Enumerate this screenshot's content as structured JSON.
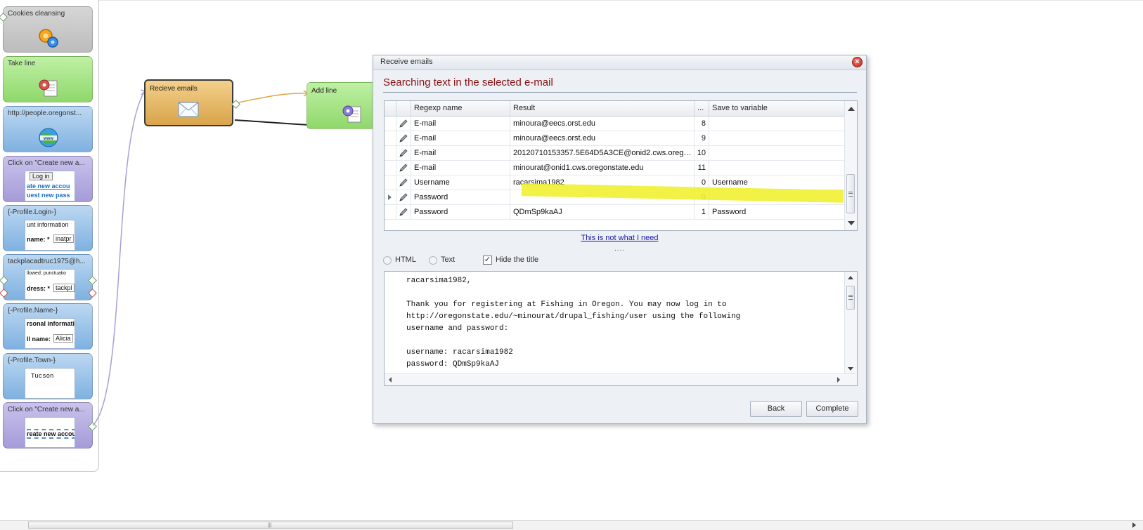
{
  "sidebar": {
    "nodes": [
      {
        "title": "Cookies cleansing"
      },
      {
        "title": "Take line"
      },
      {
        "title": "http://people.oregonst..."
      },
      {
        "title": "Click on \"Create new a...",
        "thumb_lines": [
          "Log in",
          "ate new accou",
          "uest new pass"
        ]
      },
      {
        "title": "{-Profile.Login-}",
        "thumb_lines": [
          "unt information",
          "name: *",
          "inatpr"
        ]
      },
      {
        "title": "tackplacadtruc1975@h...",
        "thumb_lines": [
          "llowed: punctuatio",
          "dress: *",
          "tackpl"
        ]
      },
      {
        "title": "{-Profile.Name-}",
        "thumb_lines": [
          "rsonal informatio",
          "ll name:",
          "Alicia"
        ]
      },
      {
        "title": "{-Profile.Town-}",
        "thumb_lines": [
          "Tucson"
        ]
      },
      {
        "title": "Click on \"Create new a...",
        "thumb_lines": [
          "reate new accou"
        ]
      }
    ]
  },
  "canvas": {
    "receive_node": {
      "title": "Recieve emails"
    },
    "addline_node": {
      "title": "Add line"
    }
  },
  "dialog": {
    "title": "Receive emails",
    "heading": "Searching text in the selected e-mail",
    "grid": {
      "columns": [
        "Regexp name",
        "Result",
        "...",
        "Save to variable"
      ],
      "rows": [
        {
          "name": "E-mail",
          "result": "minoura@eecs.orst.edu",
          "idx": "8",
          "save": ""
        },
        {
          "name": "E-mail",
          "result": "minoura@eecs.orst.edu",
          "idx": "9",
          "save": ""
        },
        {
          "name": "E-mail",
          "result": "20120710153357.5E64D5A3CE@onid2.cws.oregon...",
          "idx": "10",
          "save": ""
        },
        {
          "name": "E-mail",
          "result": "minourat@onid1.cws.oregonstate.edu",
          "idx": "11",
          "save": ""
        },
        {
          "name": "Username",
          "result": " racarsima1982",
          "idx": "0",
          "save": "Username"
        },
        {
          "name": "Password",
          "result": "",
          "idx": "0",
          "save": ""
        },
        {
          "name": "Password",
          "result": " QDmSp9kaAJ",
          "idx": "1",
          "save": "Password"
        }
      ]
    },
    "link": "This is not what I need",
    "splitter": "....",
    "options": {
      "html": "HTML",
      "text": "Text",
      "hide_title": "Hide the title",
      "hide_title_checked": true
    },
    "email_text": "racarsima1982,\n\nThank you for registering at Fishing in Oregon. You may now log in to\nhttp://oregonstate.edu/~minourat/drupal_fishing/user using the following\nusername and password:\n\nusername: racarsima1982\npassword: QDmSp9kaAJ",
    "buttons": {
      "back": "Back",
      "complete": "Complete"
    }
  }
}
